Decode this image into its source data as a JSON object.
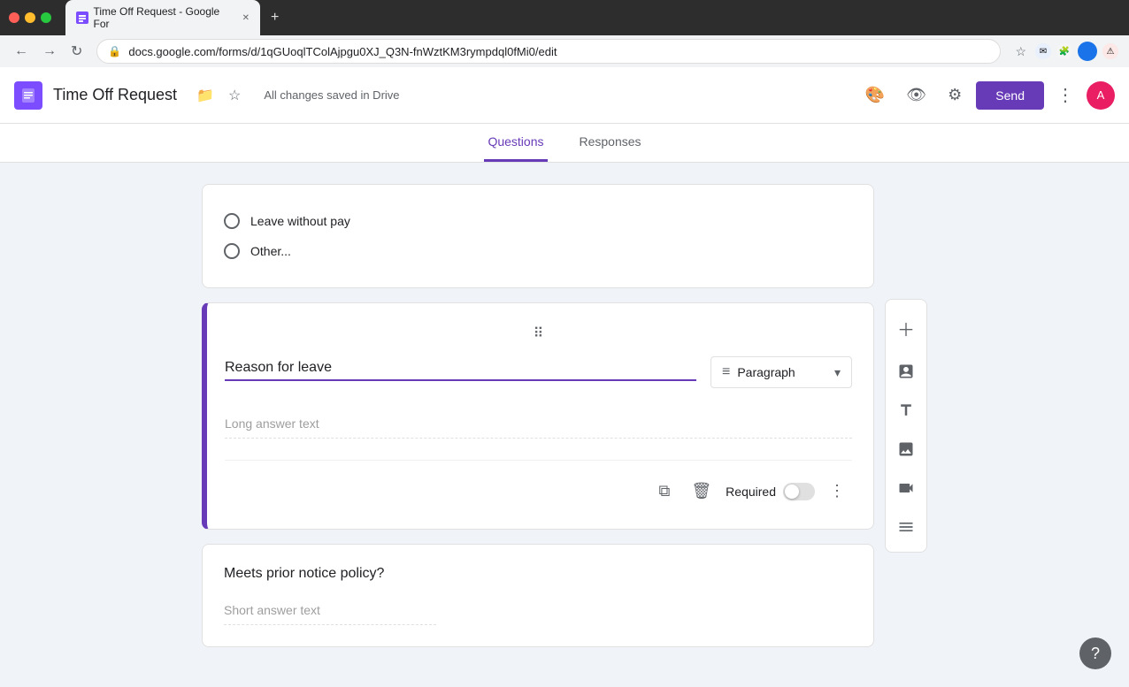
{
  "browser": {
    "tab_title": "Time Off Request - Google For",
    "url": "docs.google.com/forms/d/1qGUoqlTColAjpgu0XJ_Q3N-fnWztKM3rympdql0fMi0/edit",
    "new_tab_label": "+"
  },
  "header": {
    "title": "Time Off Request",
    "save_status": "All changes saved in Drive",
    "send_label": "Send",
    "tabs": [
      {
        "id": "questions",
        "label": "Questions",
        "active": true
      },
      {
        "id": "responses",
        "label": "Responses",
        "active": false
      }
    ]
  },
  "radio_card": {
    "options": [
      {
        "id": "leave-without-pay",
        "label": "Leave without pay"
      },
      {
        "id": "other",
        "label": "Other..."
      }
    ]
  },
  "reason_card": {
    "question_label": "Reason for leave",
    "answer_type": "Paragraph",
    "answer_placeholder": "Long answer text",
    "required_label": "Required",
    "drag_handle": "⋮⋮"
  },
  "meets_policy_card": {
    "title": "Meets prior notice policy?",
    "answer_placeholder": "Short answer text"
  },
  "sidebar": {
    "tools": [
      {
        "id": "add",
        "icon": "＋",
        "label": "Add question"
      },
      {
        "id": "import",
        "icon": "↑",
        "label": "Import questions"
      },
      {
        "id": "title",
        "icon": "T",
        "label": "Add title"
      },
      {
        "id": "image",
        "icon": "🖼",
        "label": "Add image"
      },
      {
        "id": "video",
        "icon": "▶",
        "label": "Add video"
      },
      {
        "id": "section",
        "icon": "≡",
        "label": "Add section"
      }
    ]
  },
  "help": {
    "label": "?"
  }
}
